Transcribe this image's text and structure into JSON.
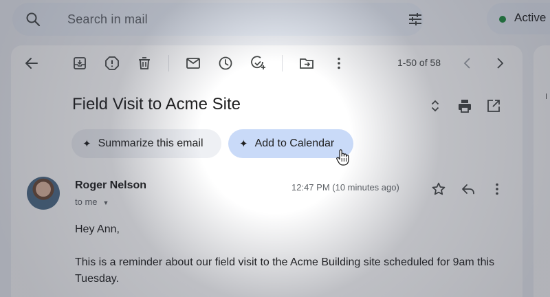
{
  "search": {
    "placeholder": "Search in mail"
  },
  "status": {
    "label": "Active",
    "color": "#1e8e3e"
  },
  "toolbar": {
    "icons": [
      "back-arrow-icon",
      "archive-icon",
      "report-spam-icon",
      "delete-icon",
      "mark-unread-icon",
      "snooze-icon",
      "add-task-icon",
      "move-to-icon",
      "more-vert-icon"
    ],
    "page_count": "1-50 of 58"
  },
  "email": {
    "subject": "Field Visit to Acme Site",
    "sender": "Roger Nelson",
    "recipient": "to me",
    "timestamp": "12:47 PM (10 minutes ago)",
    "greeting": "Hey Ann,",
    "body": "This is a reminder about our field visit to the Acme Building site scheduled for 9am this Tuesday."
  },
  "ai_chips": {
    "summarize": "Summarize this email",
    "calendar": "Add to Calendar"
  },
  "colors": {
    "calendar_chip": "#c9daf8",
    "summarize_chip": "#eef0f4"
  }
}
